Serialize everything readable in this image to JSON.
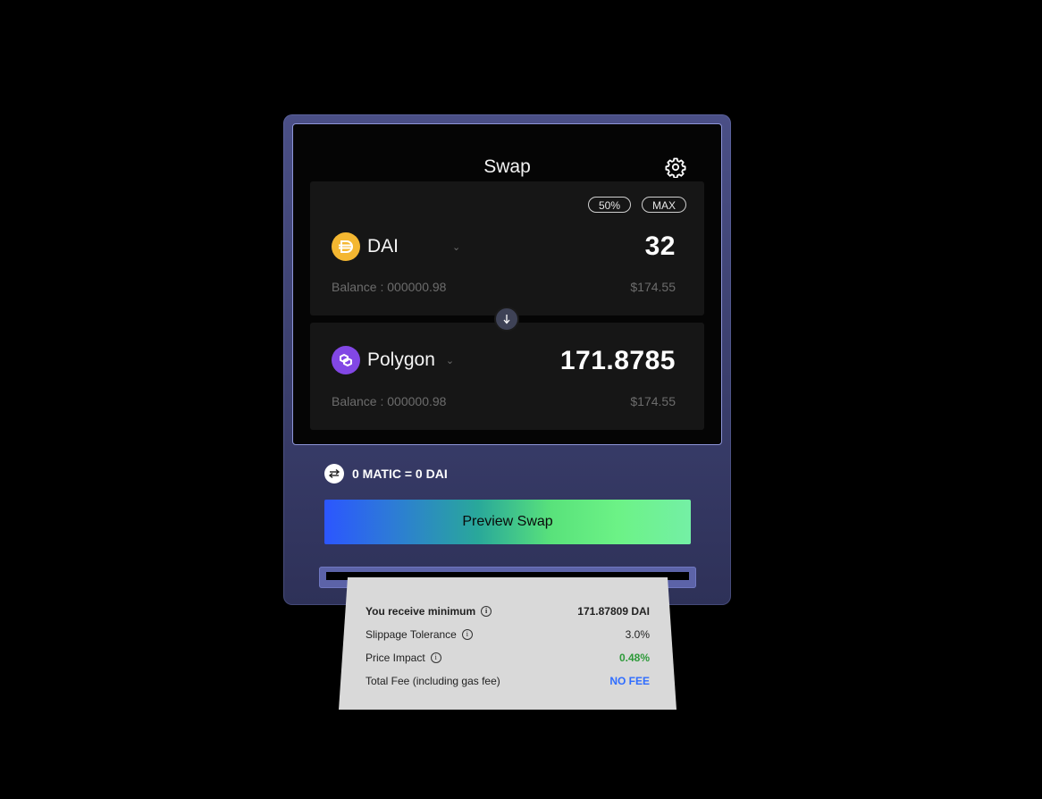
{
  "swap": {
    "title": "Swap",
    "settings_icon": "gear-icon",
    "percent_half": "50%",
    "percent_max": "MAX"
  },
  "from": {
    "token": "DAI",
    "icon": "dai-logo-icon",
    "amount": "32",
    "balance": "Balance : 000000.98",
    "usd": "$174.55",
    "color": "#f4b731"
  },
  "to": {
    "token": "Polygon",
    "icon": "polygon-logo-icon",
    "amount": "171.8785",
    "balance": "Balance : 000000.98",
    "usd": "$174.55",
    "color": "#8247e5"
  },
  "rate": {
    "text": "0 MATIC = 0 DAI",
    "icon": "swap-arrows-icon"
  },
  "actions": {
    "preview": "Preview Swap"
  },
  "receipt": {
    "rows": [
      {
        "label": "You receive minimum",
        "value": "171.87809 DAI"
      },
      {
        "label": "Slippage Tolerance",
        "value": "3.0%"
      },
      {
        "label": "Price Impact",
        "value": "0.48%"
      },
      {
        "label": "Total Fee (including gas fee)",
        "value": "NO FEE"
      }
    ],
    "info_glyph": "i"
  },
  "colors": {
    "accent_blue": "#2c56ff",
    "accent_green": "#6cf286",
    "price_impact": "#2e9a3a",
    "no_fee": "#2f6dff"
  }
}
